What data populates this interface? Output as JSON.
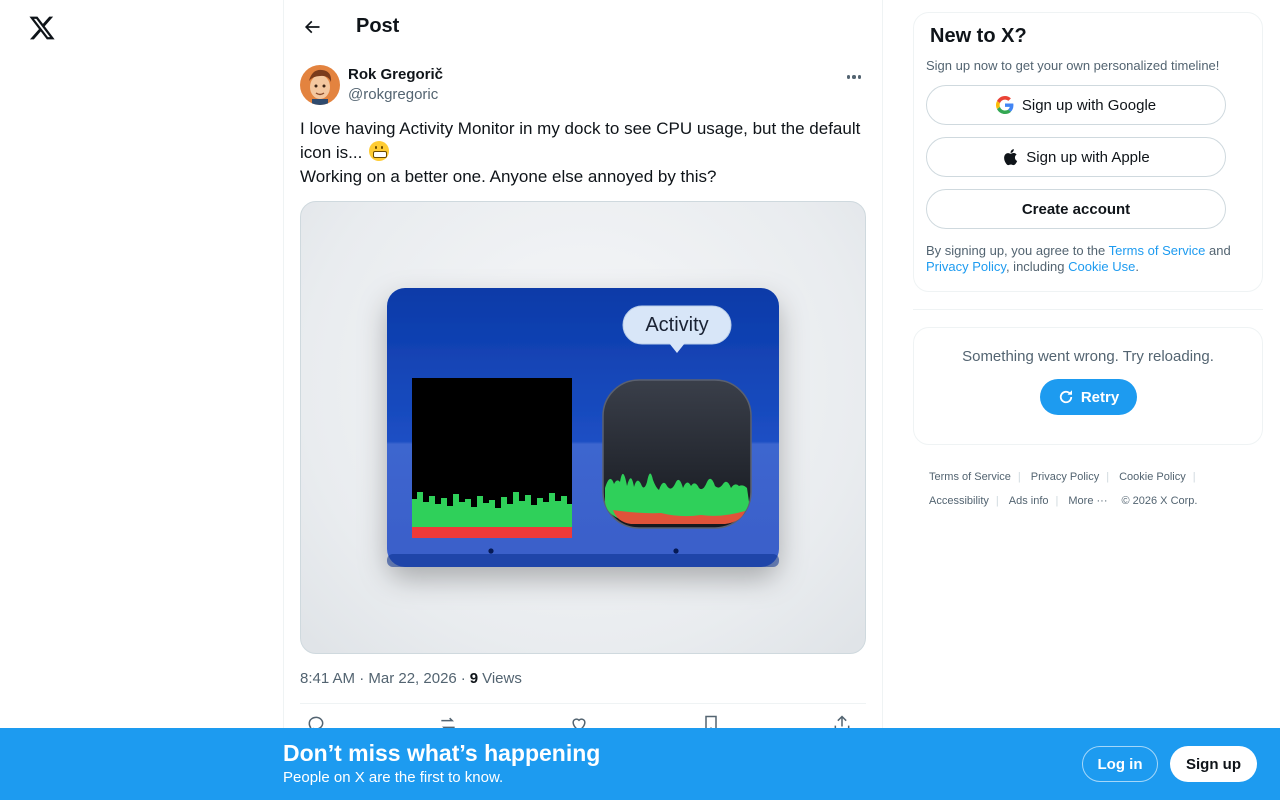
{
  "nav": {
    "logo": "x-logo-icon"
  },
  "header": {
    "title": "Post",
    "back_icon": "arrow-left-icon"
  },
  "post": {
    "author_name": "Rok Gregorič",
    "author_handle": "@rokgregoric",
    "text_line1": "I love having Activity Monitor in my dock to see CPU usage, but the default icon is... ",
    "text_line2": "Working on a better one. Anyone else annoyed by this?",
    "emoji": "grimacing-face-emoji",
    "image": {
      "tooltip_label": "Activity"
    },
    "time": "8:41 AM · Mar 22, 2026",
    "dot": "·",
    "views_count": "9",
    "views_label": "Views",
    "action_icons": [
      "reply-icon",
      "repost-icon",
      "like-icon",
      "bookmark-icon",
      "share-icon"
    ]
  },
  "signup_card": {
    "title": "New to X?",
    "subtitle": "Sign up now to get your own personalized timeline!",
    "google_label": "Sign up with Google",
    "apple_label": "Sign up with Apple",
    "create_label": "Create account",
    "legal_prefix": "By signing up, you agree to the ",
    "terms_link": "Terms of Service",
    "legal_and": " and ",
    "privacy_link": "Privacy Policy",
    "legal_including": ", including ",
    "cookie_link": "Cookie Use",
    "legal_end": "."
  },
  "error_card": {
    "message": "Something went wrong. Try reloading.",
    "retry_label": "Retry"
  },
  "footer": {
    "terms": "Terms of Service",
    "privacy": "Privacy Policy",
    "cookie": "Cookie Policy",
    "accessibility": "Accessibility",
    "ads": "Ads info",
    "more": "More ···",
    "copyright": "© 2026 X Corp."
  },
  "banner": {
    "title": "Don’t miss what’s happening",
    "subtitle": "People on X are the first to know.",
    "login_label": "Log in",
    "signup_label": "Sign up"
  },
  "colors": {
    "accent": "#1d9bf0",
    "text": "#0f1419",
    "muted": "#536471"
  }
}
